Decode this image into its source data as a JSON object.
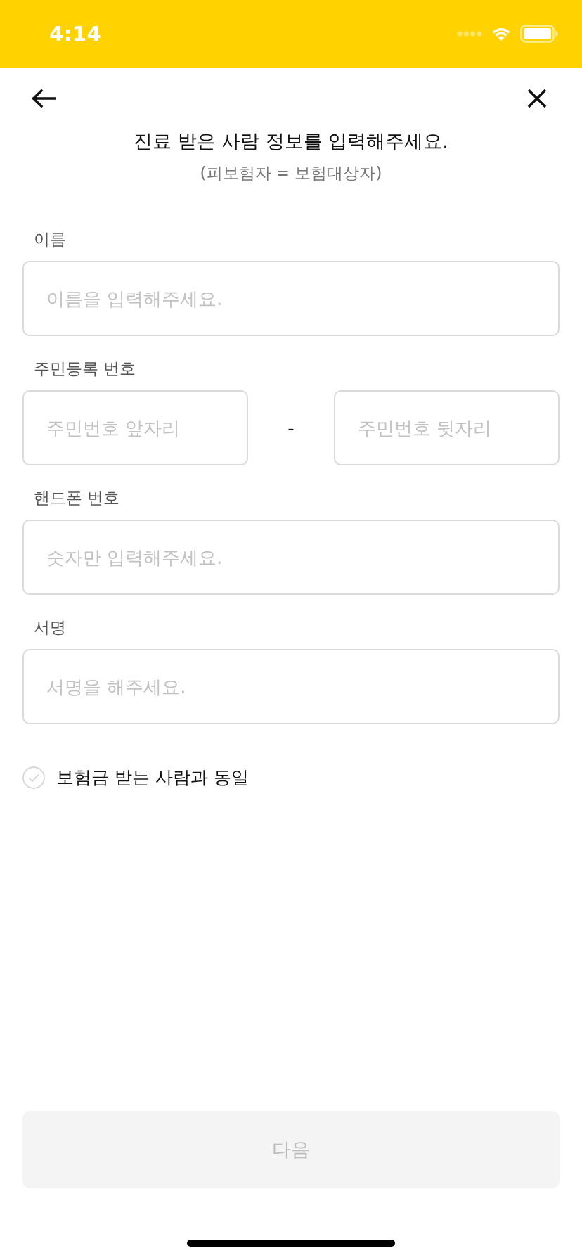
{
  "status_bar": {
    "time": "4:14"
  },
  "header": {
    "title": "진료 받은 사람 정보를 입력해주세요.",
    "subtitle": "(피보험자 = 보험대상자)"
  },
  "fields": [
    {
      "kind": "single",
      "label": "이름",
      "placeholder": "이름을 입력해주세요."
    },
    {
      "kind": "split",
      "label": "주민등록 번호",
      "parts": [
        {
          "placeholder": "주민번호 앞자리"
        },
        {
          "placeholder": "주민번호 뒷자리"
        }
      ],
      "separator": "-"
    },
    {
      "kind": "single",
      "label": "핸드폰 번호",
      "placeholder": "숫자만 입력해주세요."
    },
    {
      "kind": "single",
      "label": "서명",
      "placeholder": "서명을 해주세요."
    }
  ],
  "same_as_recipient": {
    "label": "보험금 받는 사람과 동일",
    "checked": false
  },
  "next_button": {
    "label": "다음",
    "disabled": true
  }
}
